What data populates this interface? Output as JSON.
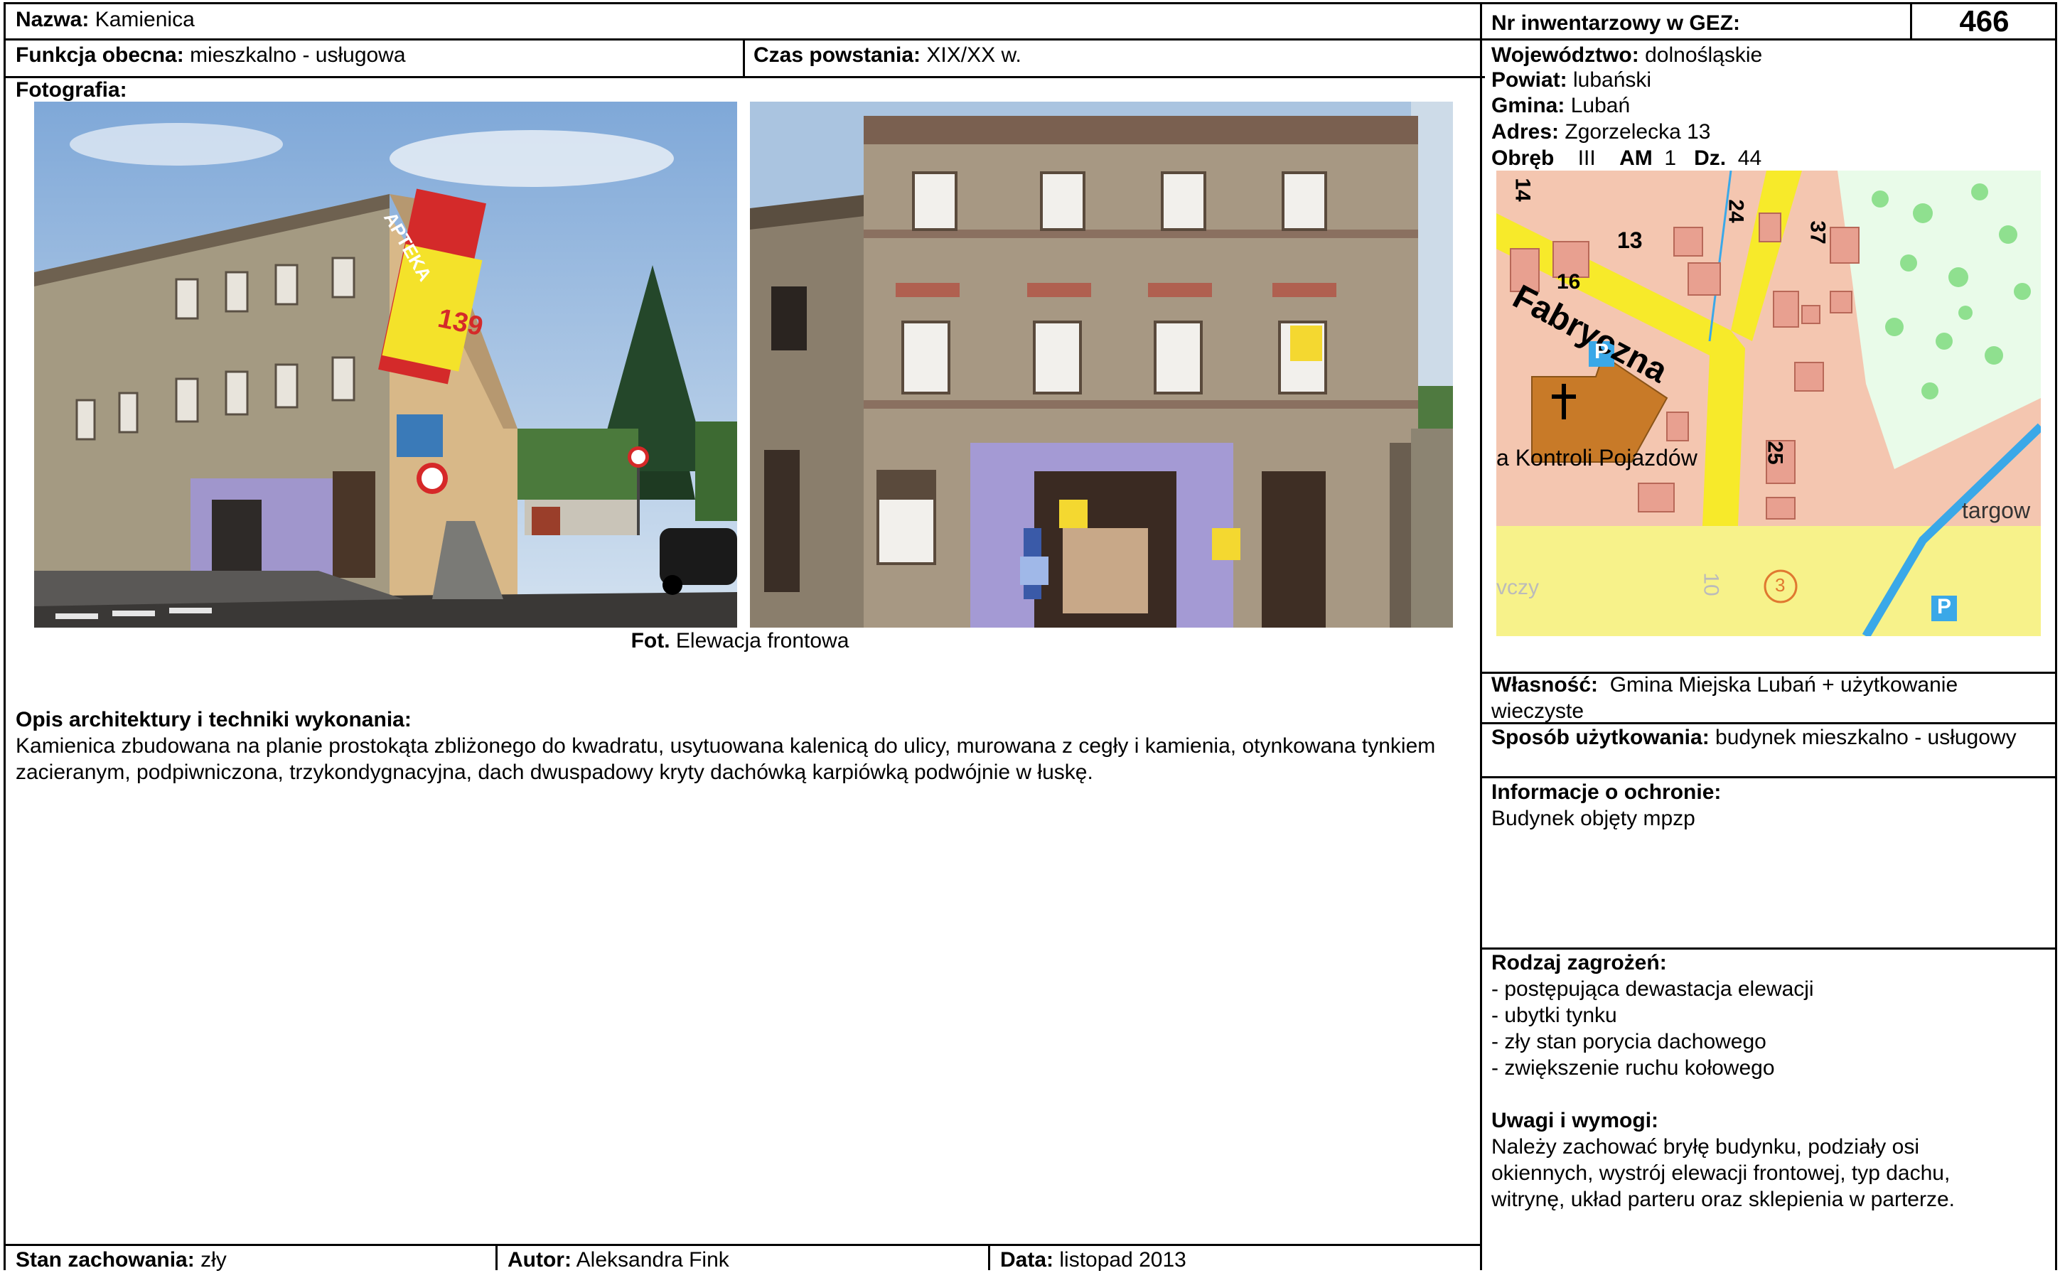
{
  "header": {
    "name_label": "Nazwa:",
    "name_value": "Kamienica",
    "inv_label": "Nr inwentarzowy w GEZ:",
    "inv_value": "466",
    "function_label": "Funkcja obecna:",
    "function_value": "mieszkalno - usługowa",
    "time_label": "Czas powstania:",
    "time_value": "XIX/XX w."
  },
  "location": {
    "voivodeship_label": "Województwo:",
    "voivodeship_value": "dolnośląskie",
    "county_label": "Powiat:",
    "county_value": "lubański",
    "commune_label": "Gmina:",
    "commune_value": "Lubań",
    "address_label": "Adres:",
    "address_value": "Zgorzelecka 13",
    "precinct_label": "Obręb",
    "precinct_value": "III",
    "am_label": "AM",
    "am_value": "1",
    "plot_label": "Dz.",
    "plot_value": "44"
  },
  "map": {
    "street_label": "Fabryczna",
    "poi_label": "a Kontroli Pojazdów",
    "targ_label": "targow",
    "corner_label": "vczy",
    "n14": "14",
    "n13": "13",
    "n16": "16",
    "n24": "24",
    "n37": "37",
    "n25": "25",
    "n10": "10",
    "nr3": "3",
    "parking": "P",
    "colors": {
      "land": "#f4c6b0",
      "road": "#f7ea2a",
      "building": "#e8a090",
      "church": "#c87a28",
      "forest": "#b8f0b8",
      "water": "#3aa8e8"
    }
  },
  "photo": {
    "label": "Fotografia:",
    "caption_bold": "Fot.",
    "caption_text": "Elewacja frontowa",
    "pharmacy_sign": "APTEKA",
    "price_sign": "139"
  },
  "description": {
    "label": "Opis architektury i techniki wykonania:",
    "text": "Kamienica zbudowana na planie prostokąta zbliżonego do kwadratu, usytuowana kalenicą do ulicy, murowana z cegły i kamienia, otynkowana tynkiem zacieranym, podpiwniczona, trzykondygnacyjna, dach dwuspadowy kryty dachówką karpiówką podwójnie w łuskę."
  },
  "ownership": {
    "label": "Własność:",
    "value": "Gmina Miejska Lubań + użytkowanie wieczyste"
  },
  "usage": {
    "label": "Sposób użytkowania:",
    "value": "budynek mieszkalno - usługowy"
  },
  "protection": {
    "label": "Informacje o ochronie:",
    "value": "Budynek objęty mpzp"
  },
  "threats": {
    "label": "Rodzaj zagrożeń:",
    "items": [
      "- postępująca dewastacja elewacji",
      "- ubytki tynku",
      "- zły stan porycia dachowego",
      "- zwiększenie ruchu kołowego"
    ]
  },
  "remarks": {
    "label": "Uwagi i wymogi:",
    "text": "Należy zachować bryłę budynku, podziały osi okiennych, wystrój elewacji frontowej, typ dachu, witrynę, układ parteru oraz sklepienia w parterze."
  },
  "footer": {
    "condition_label": "Stan zachowania:",
    "condition_value": "zły",
    "author_label": "Autor:",
    "author_value": "Aleksandra Fink",
    "date_label": "Data:",
    "date_value": "listopad 2013"
  }
}
